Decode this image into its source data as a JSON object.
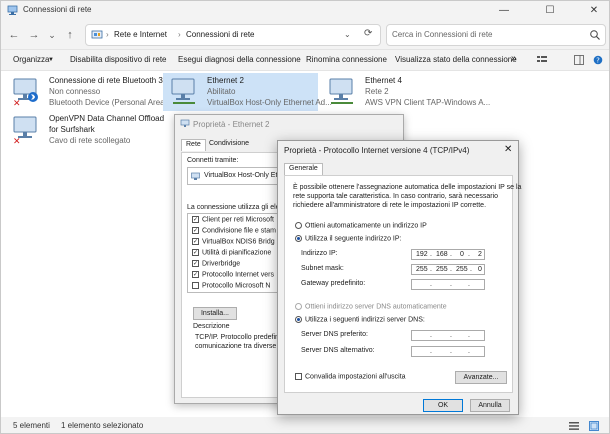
{
  "window": {
    "title": "Connessioni di rete",
    "minimize": "—",
    "maximize": "☐",
    "close": "✕"
  },
  "nav": {
    "back": "←",
    "forward": "→",
    "history": "⌄",
    "up": "↑",
    "breadcrumb": [
      "Rete e Internet",
      "Connessioni di rete"
    ],
    "separator": "›",
    "dropdown": "⌄",
    "refresh": "⟳",
    "search_placeholder": "Cerca in Connessioni di rete"
  },
  "commands": [
    "Organizza",
    "Disabilita dispositivo di rete",
    "Esegui diagnosi della connessione",
    "Rinomina connessione",
    "Visualizza stato della connessione"
  ],
  "command_overflow": "»",
  "connections": [
    {
      "name": "Connessione di rete Bluetooth 3",
      "status": "Non connesso",
      "device": "Bluetooth Device (Personal Area ..."
    },
    {
      "name": "Ethernet 2",
      "status": "Abilitato",
      "device": "VirtualBox Host-Only Ethernet Ad..."
    },
    {
      "name": "Ethernet 4",
      "status": "Rete 2",
      "device": "AWS VPN Client TAP-Windows A..."
    },
    {
      "name": "OpenVPN Data Channel Offload",
      "status": "for Surfshark",
      "device": "Cavo di rete scollegato"
    }
  ],
  "statusbar": {
    "count": "5 elementi",
    "selected": "1 elemento selezionato"
  },
  "props": {
    "title": "Proprietà - Ethernet 2",
    "tabs": [
      "Rete",
      "Condivisione"
    ],
    "connect_using_label": "Connetti tramite:",
    "adapter": "VirtualBox Host-Only Ethe",
    "uses_label": "La connessione utilizza gli eleme",
    "components": [
      {
        "label": "Client per reti Microsoft",
        "checked": true
      },
      {
        "label": "Condivisione file e stam",
        "checked": true
      },
      {
        "label": "VirtualBox NDIS6 Bridg",
        "checked": true
      },
      {
        "label": "Utilità di pianificazione",
        "checked": true
      },
      {
        "label": "Driverbridge",
        "checked": true
      },
      {
        "label": "Protocollo Internet vers",
        "checked": true
      },
      {
        "label": "Protocollo Microsoft N",
        "checked": false
      }
    ],
    "install_button": "Installa...",
    "description_label": "Descrizione",
    "description_text": [
      "TCP/IP. Protocollo predefinit",
      "comunicazione tra diverse ret"
    ]
  },
  "ipv4": {
    "title": "Proprietà - Protocollo Internet versione 4 (TCP/IPv4)",
    "tab": "Generale",
    "intro": [
      "È possibile ottenere l'assegnazione automatica delle impostazioni IP se la",
      "rete supporta tale caratteristica. In caso contrario, sarà necessario",
      "richiedere all'amministratore di rete le impostazioni IP corrette."
    ],
    "auto_ip": "Ottieni automaticamente un indirizzo IP",
    "manual_ip": "Utilizza il seguente indirizzo IP:",
    "ip_label": "Indirizzo IP:",
    "ip_value": [
      "192",
      "168",
      "0",
      "2"
    ],
    "mask_label": "Subnet mask:",
    "mask_value": [
      "255",
      "255",
      "255",
      "0"
    ],
    "gateway_label": "Gateway predefinito:",
    "auto_dns": "Ottieni indirizzo server DNS automaticamente",
    "manual_dns": "Utilizza i seguenti indirizzi server DNS:",
    "dns_pref_label": "Server DNS preferito:",
    "dns_alt_label": "Server DNS alternativo:",
    "validate": "Convalida impostazioni all'uscita",
    "advanced_button": "Avanzate...",
    "ok_button": "OK",
    "cancel_button": "Annulla"
  }
}
